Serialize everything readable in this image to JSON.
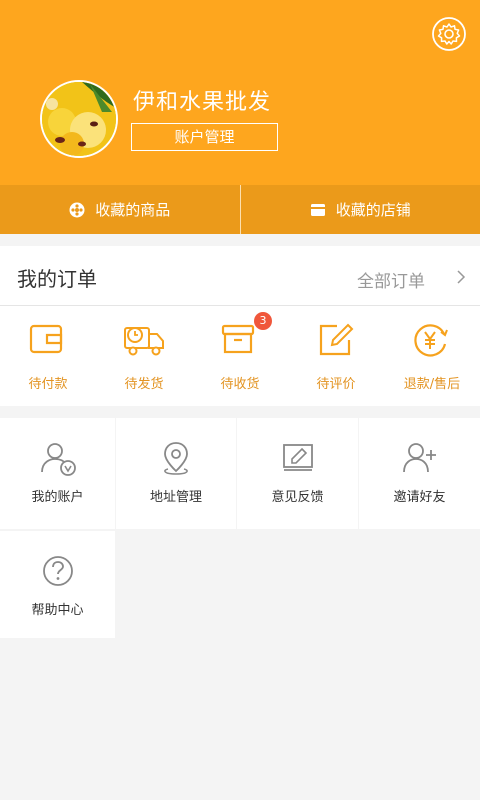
{
  "colors": {
    "accent": "#fea61e",
    "accent_dark": "#eb9a1a",
    "badge": "#f0573b"
  },
  "profile": {
    "shop_name": "伊和水果批发",
    "account_button": "账户管理"
  },
  "favorites": [
    {
      "label": "收藏的商品",
      "icon": "flower-icon"
    },
    {
      "label": "收藏的店铺",
      "icon": "store-icon"
    }
  ],
  "orders": {
    "title": "我的订单",
    "all_link": "全部订单",
    "items": [
      {
        "label": "待付款",
        "icon": "wallet-icon"
      },
      {
        "label": "待发货",
        "icon": "delivery-truck-icon"
      },
      {
        "label": "待收货",
        "icon": "box-icon",
        "badge": "3"
      },
      {
        "label": "待评价",
        "icon": "edit-icon"
      },
      {
        "label": "退款/售后",
        "icon": "yen-refund-icon"
      }
    ]
  },
  "grid": [
    {
      "label": "我的账户",
      "icon": "user-icon"
    },
    {
      "label": "地址管理",
      "icon": "location-pin-icon"
    },
    {
      "label": "意见反馈",
      "icon": "feedback-icon"
    },
    {
      "label": "邀请好友",
      "icon": "add-user-icon"
    },
    {
      "label": "帮助中心",
      "icon": "help-icon"
    }
  ]
}
